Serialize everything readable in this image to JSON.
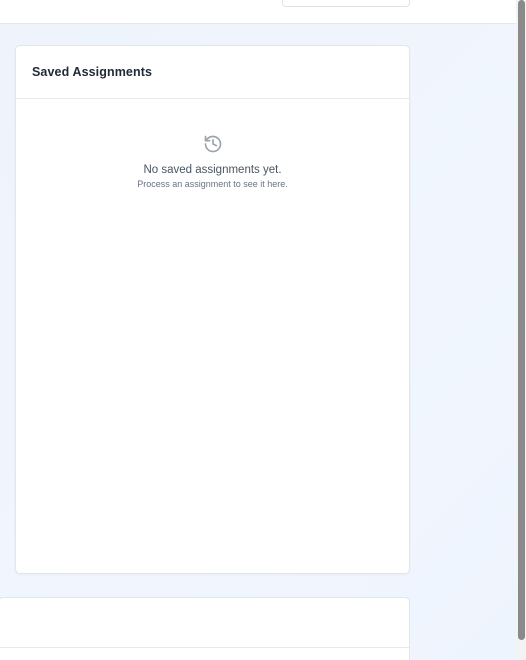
{
  "saved_assignments": {
    "title": "Saved Assignments",
    "empty_icon": "history-icon",
    "empty_title": "No saved assignments yet.",
    "empty_subtitle": "Process an assignment to see it here."
  },
  "colors": {
    "page_background": "#eef4fd",
    "card_background": "#ffffff",
    "icon": "#9ca3af"
  }
}
